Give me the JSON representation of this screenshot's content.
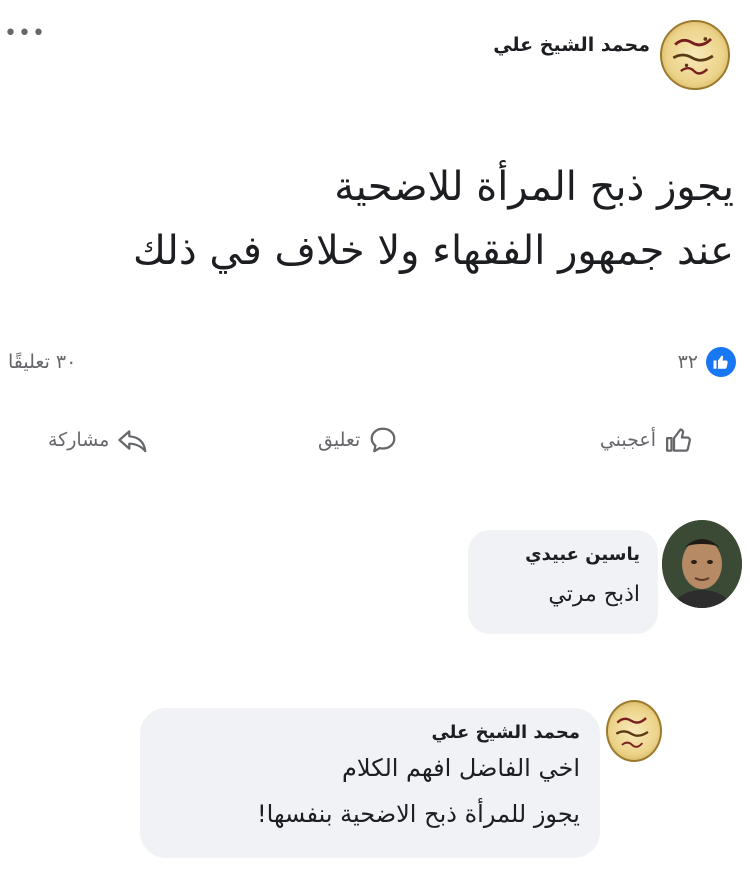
{
  "post": {
    "author": "محمد الشيخ علي",
    "more_icon": "more-dots-icon",
    "body_lines": [
      "يجوز ذبح المرأة للاضحية",
      "عند جمهور الفقهاء ولا خلاف في ذلك"
    ],
    "like_count": "٣٢",
    "comments_count": "٣٠ تعليقًا"
  },
  "actions": {
    "like_label": "أعجبني",
    "comment_label": "تعليق",
    "share_label": "مشاركة"
  },
  "comments": [
    {
      "author": "ياسين عبيدي",
      "text": "اذبح مرتي"
    },
    {
      "author": "محمد الشيخ علي",
      "lines": [
        "اخي الفاضل افهم الكلام",
        "يجوز للمرأة ذبح الاضحية بنفسها!"
      ]
    }
  ],
  "colors": {
    "facebook_blue": "#1877f2",
    "secondary_text": "#65676b",
    "bubble_bg": "#f0f2f5"
  }
}
